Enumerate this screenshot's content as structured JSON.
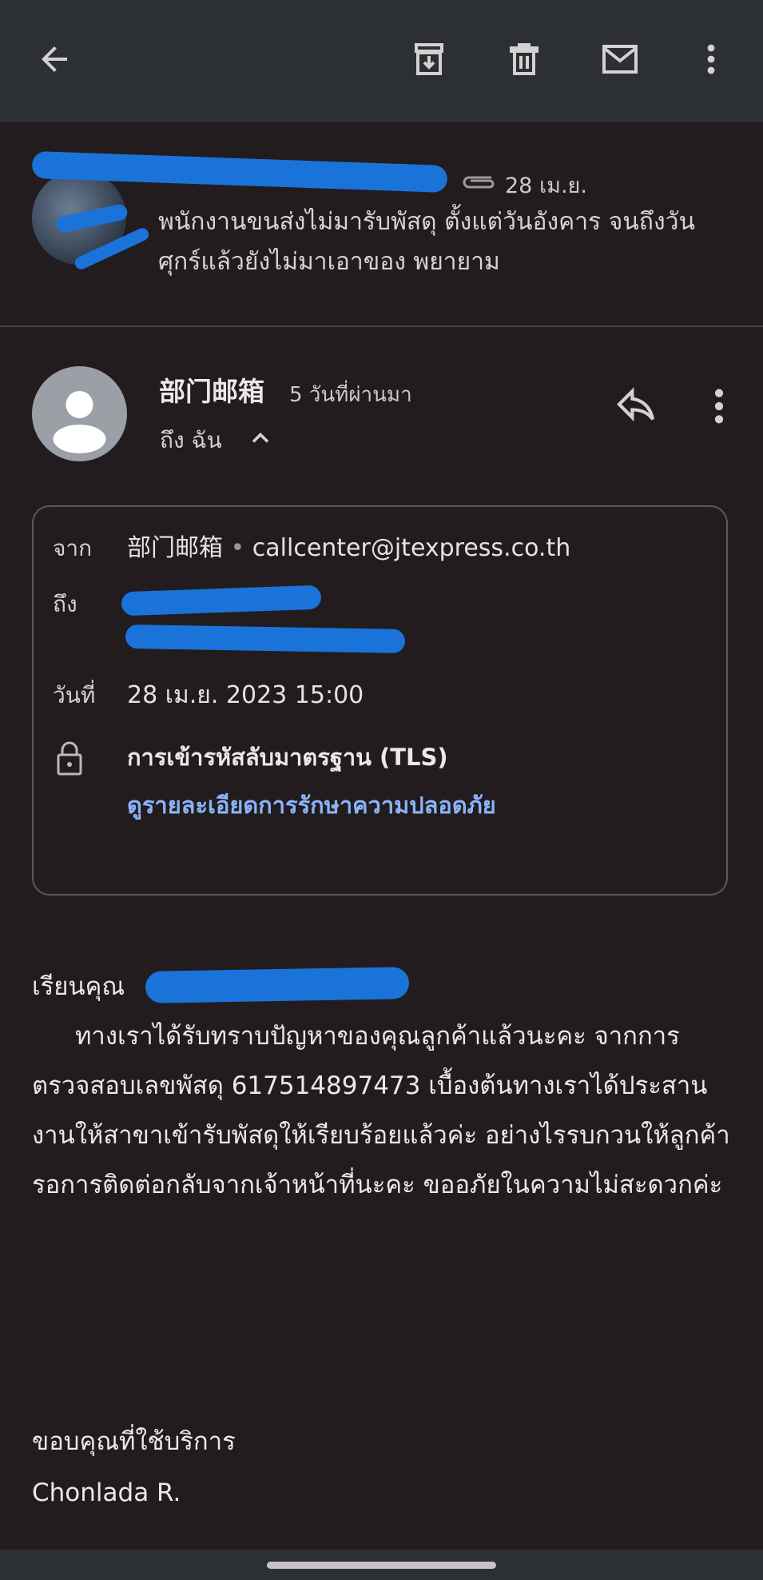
{
  "toolbar": {
    "back_icon": "arrow-left-icon",
    "archive_icon": "archive-icon",
    "delete_icon": "trash-icon",
    "mark_unread_icon": "mail-icon",
    "more_icon": "more-vertical-icon"
  },
  "thread": {
    "date": "28 เม.ย.",
    "subject": "พนักงานขนส่งไม่มารับพัสดุ ตั้งแต่วันอังคาร จนถึงวันศุกร์แล้วยังไม่มาเอาของ พยายาม"
  },
  "message": {
    "sender_name": "部门邮箱",
    "time_ago": "5 วันที่ผ่านมา",
    "to_line": "ถึง ฉัน"
  },
  "details": {
    "from_label": "จาก",
    "from_name": "部门邮箱",
    "from_email": "callcenter@jtexpress.co.th",
    "to_label": "ถึง",
    "date_label": "วันที่",
    "date_value": "28 เม.ย. 2023 15:00",
    "security_title": "การเข้ารหัสลับมาตรฐาน (TLS)",
    "security_link": "ดูรายละเอียดการรักษาความปลอดภัย"
  },
  "body": {
    "greeting": "เรียนคุณ",
    "paragraph": "ทางเราได้รับทราบปัญหาของคุณลูกค้าแล้วนะคะ จากการตรวจสอบเลขพัสดุ 617514897473 เบื้องต้นทางเราได้ประสานงานให้สาขาเข้ารับพัสดุให้เรียบร้อยแล้วค่ะ อย่างไรรบกวนให้ลูกค้ารอการติดต่อกลับจากเจ้าหน้าที่นะคะ ขออภัยในความไม่สะดวกค่ะ",
    "closing": "ขอบคุณที่ใช้บริการ",
    "signature": "Chonlada R."
  },
  "colors": {
    "background": "#221c1e",
    "toolbar": "#2c2f33",
    "link": "#8ab4f8",
    "redaction": "#1a73d9"
  }
}
